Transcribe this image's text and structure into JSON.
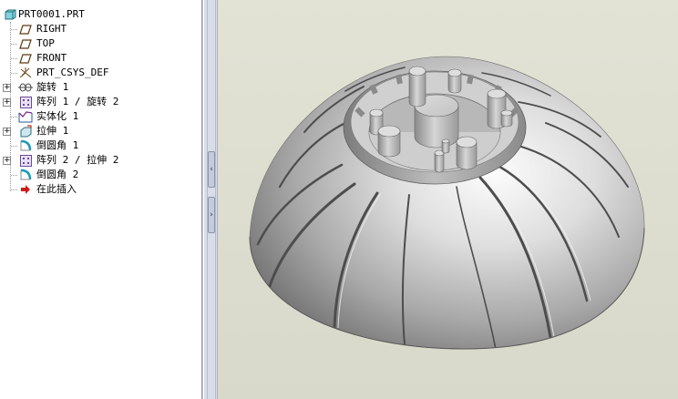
{
  "model_tree": {
    "root": {
      "label": "PRT0001.PRT",
      "icon": "part-icon"
    },
    "items": [
      {
        "label": "RIGHT",
        "icon": "datum-plane-icon",
        "expandable": false
      },
      {
        "label": "TOP",
        "icon": "datum-plane-icon",
        "expandable": false
      },
      {
        "label": "FRONT",
        "icon": "datum-plane-icon",
        "expandable": false
      },
      {
        "label": "PRT_CSYS_DEF",
        "icon": "coordinate-system-icon",
        "expandable": false
      },
      {
        "label": "旋转 1",
        "icon": "revolve-icon",
        "expandable": true
      },
      {
        "label": "阵列 1 / 旋转 2",
        "icon": "pattern-icon",
        "expandable": true
      },
      {
        "label": "实体化 1",
        "icon": "solidify-icon",
        "expandable": false
      },
      {
        "label": "拉伸 1",
        "icon": "extrude-icon",
        "expandable": true
      },
      {
        "label": "倒圆角 1",
        "icon": "round-icon",
        "expandable": false
      },
      {
        "label": "阵列 2 / 拉伸 2",
        "icon": "pattern-icon",
        "expandable": true
      },
      {
        "label": "倒圆角 2",
        "icon": "round-icon",
        "expandable": false
      },
      {
        "label": "在此插入",
        "icon": "insert-here-arrow-icon",
        "expandable": false
      }
    ],
    "expander_symbol": "+"
  },
  "splitter": {
    "collapse_symbol": "‹",
    "expand_symbol": "›"
  },
  "viewport": {
    "background": "#dcdccf",
    "model": "shaded-dome-part"
  }
}
